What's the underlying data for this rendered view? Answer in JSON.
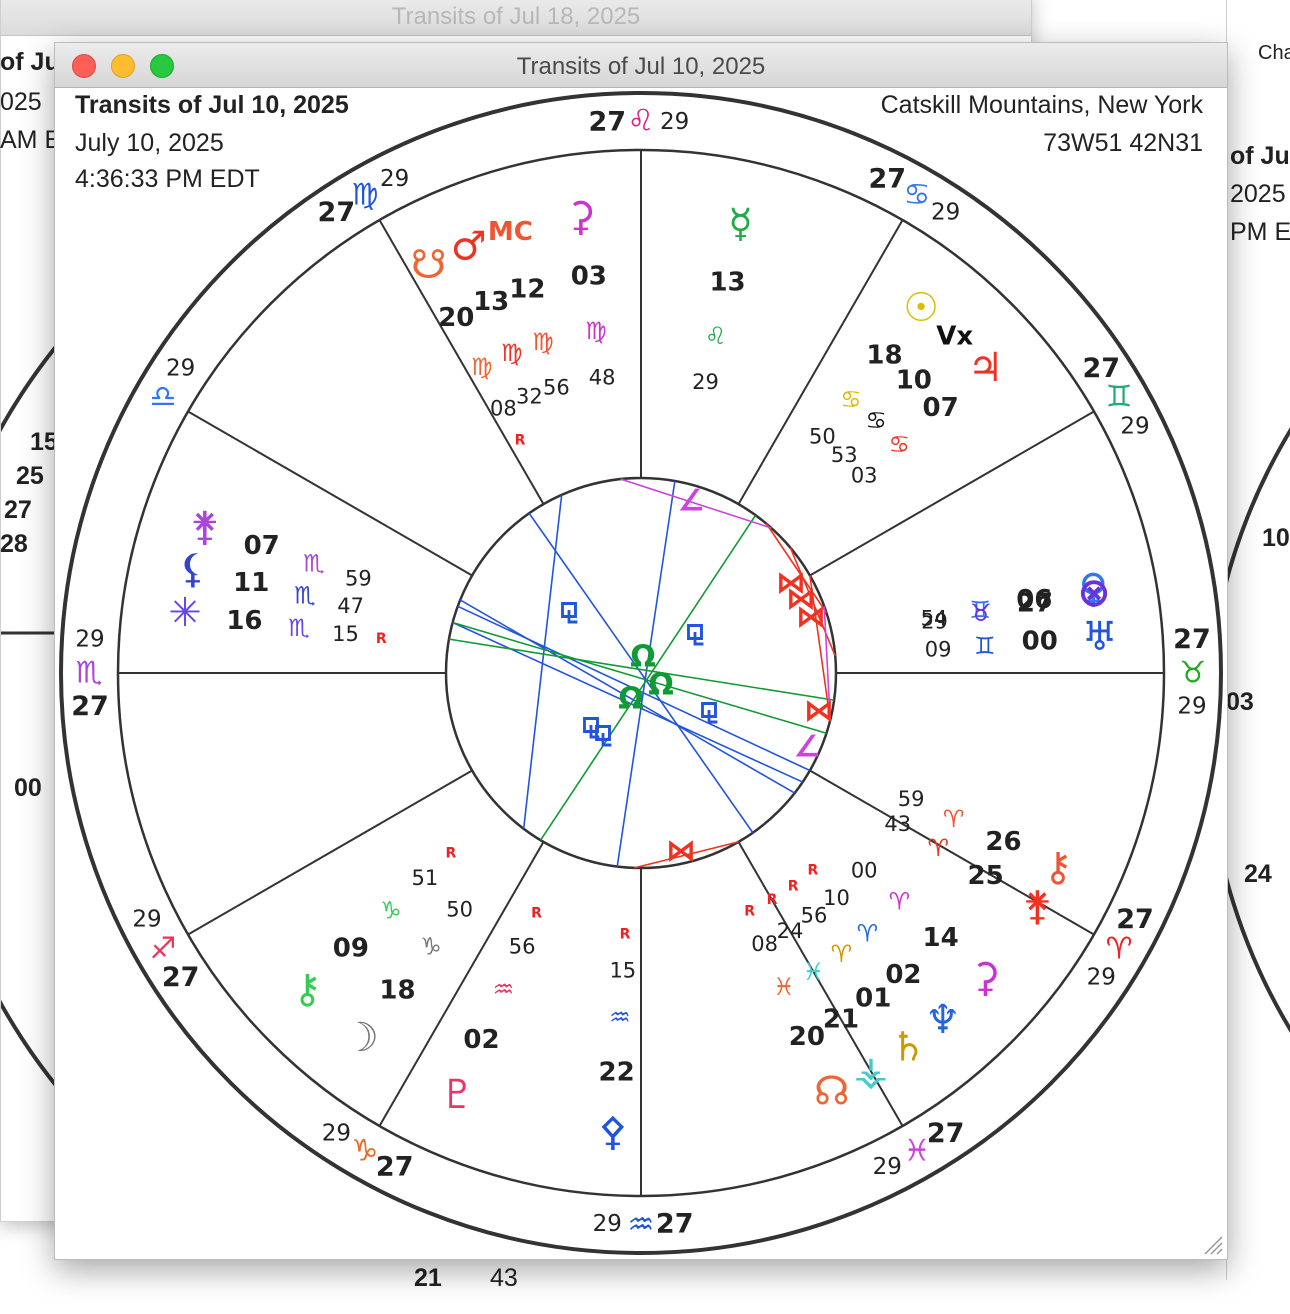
{
  "window": {
    "title": "Transits of Jul 10, 2025",
    "background_titles": [
      "Transits of Jul 18, 2025"
    ]
  },
  "chart_header": {
    "title": "Transits of Jul 10, 2025",
    "date": "July 10, 2025",
    "time": "4:36:33 PM EDT",
    "location": "Catskill Mountains, New York",
    "coordinates": "73W51 42N31"
  },
  "colors": {
    "fire": "#ee3322",
    "earth": "#22aa22",
    "air": "#3377ee",
    "water": "#5566ee",
    "aspect_blue": "#2255dd",
    "aspect_red": "#ee3322",
    "aspect_green": "#119933",
    "aspect_magenta": "#cc44dd"
  },
  "houses": [
    {
      "deg": "27",
      "sign": "♉",
      "min": "29",
      "color": "#22aa22"
    },
    {
      "deg": "27",
      "sign": "♊",
      "min": "29",
      "color": "#22aa77"
    },
    {
      "deg": "27",
      "sign": "♋",
      "min": "29",
      "color": "#3377ee"
    },
    {
      "deg": "27",
      "sign": "♌",
      "min": "29",
      "color": "#dd2288"
    },
    {
      "deg": "27",
      "sign": "♍",
      "min": "29",
      "color": "#2255dd"
    },
    {
      "deg": "",
      "sign": "♎",
      "min": "29",
      "color": "#3377ee"
    },
    {
      "deg": "27",
      "sign": "♏",
      "min": "29",
      "color": "#aa44dd"
    },
    {
      "deg": "27",
      "sign": "♐",
      "min": "29",
      "color": "#ee3355"
    },
    {
      "deg": "27",
      "sign": "♑",
      "min": "29",
      "color": "#ee6622"
    },
    {
      "deg": "27",
      "sign": "♒",
      "min": "29",
      "color": "#2255dd"
    },
    {
      "deg": "27",
      "sign": "♓",
      "min": "29",
      "color": "#cc44dd"
    },
    {
      "deg": "27",
      "sign": "♈",
      "min": "29",
      "color": "#ee2222"
    }
  ],
  "planets": [
    {
      "glyph": "♀",
      "deg": "06",
      "sign": "♊",
      "min": "54",
      "color": "#3377ee",
      "retro": false
    },
    {
      "glyph": "♅",
      "deg": "00",
      "sign": "♊",
      "min": "09",
      "color": "#2255dd",
      "retro": false
    },
    {
      "glyph": "⊗",
      "deg": "27",
      "sign": "♉",
      "min": "29",
      "color": "#6633dd",
      "retro": false
    },
    {
      "glyph": "♃",
      "deg": "07",
      "sign": "♋",
      "min": "03",
      "color": "#ee3322",
      "retro": false
    },
    {
      "glyph": "Vx",
      "deg": "10",
      "sign": "♋",
      "min": "53",
      "color": "#111111",
      "retro": false
    },
    {
      "glyph": "☉",
      "deg": "18",
      "sign": "♋",
      "min": "50",
      "color": "#ddbb00",
      "retro": false
    },
    {
      "glyph": "☿",
      "deg": "13",
      "sign": "♌",
      "min": "29",
      "color": "#22aa44",
      "retro": false
    },
    {
      "glyph": "⚳",
      "deg": "03",
      "sign": "♍",
      "min": "48",
      "color": "#cc33cc",
      "retro": false
    },
    {
      "glyph": "MC",
      "deg": "12",
      "sign": "♍",
      "min": "56",
      "color": "#ee5533",
      "retro": false
    },
    {
      "glyph": "♂",
      "deg": "13",
      "sign": "♍",
      "min": "32",
      "color": "#ee3322",
      "retro": false
    },
    {
      "glyph": "☋",
      "deg": "20",
      "sign": "♍",
      "min": "08",
      "color": "#ee6633",
      "retro": true
    },
    {
      "glyph": "⚵",
      "deg": "07",
      "sign": "♏",
      "min": "59",
      "color": "#aa44dd",
      "retro": false
    },
    {
      "glyph": "⚸",
      "deg": "11",
      "sign": "♏",
      "min": "47",
      "color": "#3344cc",
      "retro": false
    },
    {
      "glyph": "✳",
      "deg": "16",
      "sign": "♏",
      "min": "15",
      "color": "#6644ee",
      "retro": true
    },
    {
      "glyph": "⚷",
      "deg": "09",
      "sign": "♑",
      "min": "51",
      "color": "#33cc55",
      "retro": true
    },
    {
      "glyph": "☽",
      "deg": "18",
      "sign": "♑",
      "min": "50",
      "color": "#777777",
      "retro": false
    },
    {
      "glyph": "♇",
      "deg": "02",
      "sign": "♒",
      "min": "56",
      "color": "#ee3366",
      "retro": true
    },
    {
      "glyph": "⚴",
      "deg": "22",
      "sign": "♒",
      "min": "15",
      "color": "#2255dd",
      "retro": true
    },
    {
      "glyph": "☊",
      "deg": "20",
      "sign": "♓",
      "min": "08",
      "color": "#ee6633",
      "retro": true
    },
    {
      "glyph": "⚶",
      "deg": "21",
      "sign": "♓",
      "min": "24",
      "color": "#44cccc",
      "retro": true
    },
    {
      "glyph": "♄",
      "deg": "01",
      "sign": "♈",
      "min": "56",
      "color": "#cc9900",
      "retro": true
    },
    {
      "glyph": "♆",
      "deg": "02",
      "sign": "♈",
      "min": "10",
      "color": "#2266dd",
      "retro": true
    },
    {
      "glyph": "⚳",
      "deg": "14",
      "sign": "♈",
      "min": "00",
      "color": "#cc33cc",
      "retro": false
    },
    {
      "glyph": "⚵",
      "deg": "25",
      "sign": "♈",
      "min": "43",
      "color": "#ee3322",
      "retro": false
    },
    {
      "glyph": "⚷",
      "deg": "26",
      "sign": "♈",
      "min": "59",
      "color": "#ee5533",
      "retro": false
    }
  ],
  "aspect_marks": [
    {
      "glyph": "⚼",
      "color": "#2255dd"
    },
    {
      "glyph": "Ω",
      "color": "#119933"
    },
    {
      "glyph": "⋈",
      "color": "#ee3322"
    },
    {
      "glyph": "∠",
      "color": "#cc44dd"
    }
  ],
  "background_peek": [
    "of Ju",
    "025",
    "AM E",
    "15",
    "25",
    "27",
    "28",
    "00",
    "21",
    "43",
    "of Ju",
    "2025",
    "PM E",
    "10",
    "03",
    "24",
    "Cha"
  ]
}
